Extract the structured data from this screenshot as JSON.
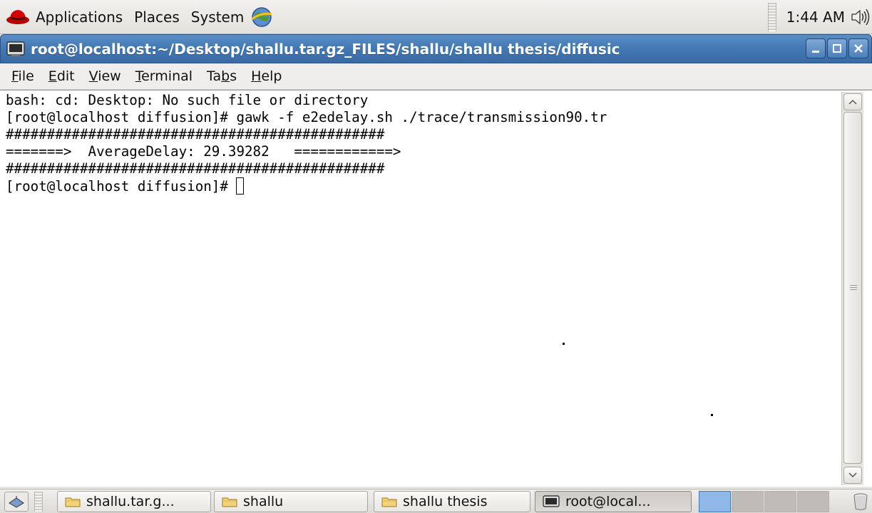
{
  "top_panel": {
    "menus": [
      "Applications",
      "Places",
      "System"
    ],
    "clock": "1:44 AM",
    "icons": {
      "distro": "redhat-icon",
      "browser": "globe-icon",
      "volume": "volume-icon"
    }
  },
  "window": {
    "title": "root@localhost:~/Desktop/shallu.tar.gz_FILES/shallu/shallu thesis/diffusic",
    "controls": {
      "minimize": "minimize",
      "maximize": "maximize",
      "close": "close"
    }
  },
  "menubar": {
    "items": [
      {
        "mnemonic": "F",
        "rest": "ile"
      },
      {
        "mnemonic": "E",
        "rest": "dit"
      },
      {
        "mnemonic": "V",
        "rest": "iew"
      },
      {
        "mnemonic": "T",
        "rest": "erminal"
      },
      {
        "pre": "Ta",
        "mnemonic": "b",
        "rest": "s"
      },
      {
        "mnemonic": "H",
        "rest": "elp"
      }
    ]
  },
  "terminal": {
    "lines": [
      "bash: cd: Desktop: No such file or directory",
      "[root@localhost diffusion]# gawk -f e2edelay.sh ./trace/transmission90.tr",
      "##############################################",
      "=======>  AverageDelay: 29.39282   ============>",
      "##############################################"
    ],
    "prompt": "[root@localhost diffusion]# "
  },
  "taskbar": {
    "tasks": [
      "shallu.tar.g...",
      "shallu",
      "shallu thesis",
      "root@local..."
    ],
    "active_index": 3
  },
  "colors": {
    "titlebar": "#4479b5",
    "panel": "#e8e6e3",
    "terminal_bg": "#ffffff",
    "terminal_fg": "#000000"
  }
}
